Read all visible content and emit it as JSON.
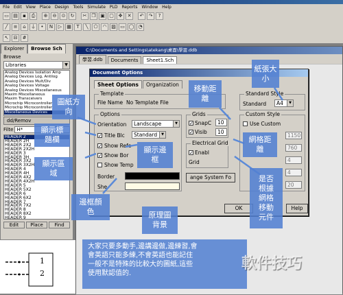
{
  "menu": [
    "File",
    "Edit",
    "View",
    "Place",
    "Design",
    "Tools",
    "Simulate",
    "PLD",
    "Reports",
    "Window",
    "Help"
  ],
  "toolbar_icons": [
    "new-icon",
    "open-icon",
    "save-icon",
    "print-icon",
    "zoom-in-icon",
    "zoom-out-icon",
    "zoom-fit-icon",
    "refresh-icon",
    "cut-icon",
    "copy-icon",
    "paste-icon",
    "select-icon",
    "move-icon",
    "cross-icon",
    "undo-icon",
    "redo-icon",
    "help-icon",
    "wire-icon",
    "bus-icon",
    "part-icon",
    "power-icon",
    "text-icon"
  ],
  "left_panel": {
    "tabs": [
      "Explorer",
      "Browse Sch"
    ],
    "browse_label": "Browse",
    "libraries_value": "Libraries",
    "libraries": [
      "Analog Devices Isolation Amp",
      "Analog Devices Log, Antilog",
      "Analog Devices Mult/Div",
      "Analog Devices Voltage",
      "Analog Devices Miscellaneous",
      "Maxim Miscellaneous",
      "Maxim Transceivers",
      "Microchip Microcontroller",
      "Microchip Microcontroller",
      "Miscellaneous Devices"
    ],
    "selected_library_index": 9,
    "dd_remove_label": "dd/Remov",
    "filter_label": "Filte",
    "filter_value": "H*",
    "parts": [
      "HEADER 2",
      "HEADER 2H",
      "HEADER 2X2",
      "HEADER 2X2H",
      "HEADER 3",
      "HEADER 3H",
      "HEADER 3X2",
      "HEADER 3X2H",
      "HEADER 4",
      "HEADER 4H",
      "HEADER 4X2",
      "HEADER 4X2H",
      "HEADER 5",
      "HEADER 5X2",
      "HEADER 6",
      "HEADER 6X2",
      "HEADER 7",
      "HEADER 7X2",
      "HEADER 8",
      "HEADER 8X2",
      "HEADER 9"
    ],
    "selected_part_index": 0,
    "buttons": [
      "Edit",
      "Place",
      "Find"
    ]
  },
  "document": {
    "title": "C:\\Documents and Settings\\atekang\\桌面\\學習.ddb",
    "tabs": [
      "學習.ddb",
      "Documents",
      "Sheet1.Sch"
    ],
    "active_tab_index": 2
  },
  "dialog": {
    "title": "Document Options",
    "tabs": [
      "Sheet Options",
      "Organization"
    ],
    "template": {
      "group": "Template",
      "file_label": "File Name",
      "file_value": "No Template File"
    },
    "options": {
      "group": "Options",
      "orientation_label": "Orientation",
      "orientation_value": "Landscape",
      "title_block_label": "Title Blc",
      "title_block_value": "Standard",
      "title_block_checked": true,
      "show_reference_label": "Show Refe",
      "show_reference_checked": true,
      "show_border_label": "Show Bor",
      "show_border_checked": true,
      "show_template_label": "Show Temp",
      "show_template_checked": false,
      "border_label": "Border",
      "sheet_label": "She",
      "border_color": "#000000",
      "sheet_color": "#fffbe6"
    },
    "grids": {
      "group": "Grids",
      "snap_label": "SnapC",
      "snap_checked": true,
      "snap_value": "10",
      "visible_label": "Visib",
      "visible_checked": true,
      "visible_value": "10"
    },
    "electrical_grid": {
      "group": "Electrical Grid",
      "enable_label": "Enabl",
      "enable_checked": true,
      "grid_label": "Grid"
    },
    "change_system_font_label": "ange System Fo",
    "standard_style": {
      "group": "Standard Style",
      "standard_label": "Standard",
      "standard_value": "A4"
    },
    "custom_style": {
      "group": "Custom Style",
      "use_custom_label": "Use Custom",
      "use_custom_checked": false,
      "values": [
        "1150",
        "760",
        "4",
        "4",
        "20"
      ]
    },
    "ok_label": "OK",
    "help_label": "Help"
  },
  "annotations": {
    "paper_size": "紙張大\n小",
    "move_distance": "移動距\n離",
    "paper_orientation": "圖紙方\n向",
    "show_title_block": "顯示標\n題欄",
    "show_border": "顯示邊\n框",
    "show_area": "顯示區\n域",
    "grid_distance": "網格距\n離",
    "follow_grid": "是否\n根據\n網格\n移動\n元件",
    "border_color": "邊框顏\n色",
    "sheet_background": "原理圖\n背景",
    "footer": "大家只要多動手,邊講邊做,邊練習,會\n會英語只能多練,不會英語也能記住\n一般不是特殊的比較大的圖紙,這些\n使用默認值的."
  },
  "canvas": {
    "pin_labels": [
      "1",
      "2"
    ]
  },
  "watermark": "軟件技巧"
}
